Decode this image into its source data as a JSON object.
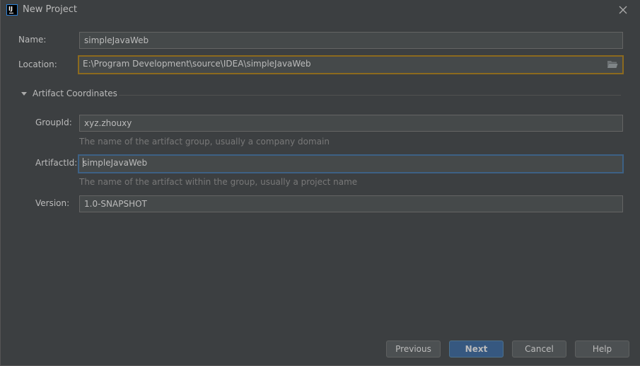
{
  "window": {
    "title": "New Project",
    "app_icon_text": "IJ",
    "close_icon": "close-icon"
  },
  "form": {
    "name": {
      "label": "Name:",
      "value": "simpleJavaWeb"
    },
    "location": {
      "label": "Location:",
      "value": "E:\\Program Development\\source\\IDEA\\simpleJavaWeb",
      "browse_icon": "folder-icon"
    },
    "artifact_section": {
      "title": "Artifact Coordinates",
      "expanded": true,
      "group_id": {
        "label": "GroupId:",
        "value": "xyz.zhouxy",
        "hint": "The name of the artifact group, usually a company domain"
      },
      "artifact_id": {
        "label": "ArtifactId:",
        "value": "simpleJavaWeb",
        "hint": "The name of the artifact within the group, usually a project name"
      },
      "version": {
        "label": "Version:",
        "value": "1.0-SNAPSHOT"
      }
    }
  },
  "buttons": {
    "previous": "Previous",
    "next": "Next",
    "cancel": "Cancel",
    "help": "Help"
  },
  "colors": {
    "background": "#3c3f41",
    "field_bg": "#45494a",
    "warning_border": "#8c6a1e",
    "focus_border": "#3d6185",
    "primary_button": "#365880"
  }
}
